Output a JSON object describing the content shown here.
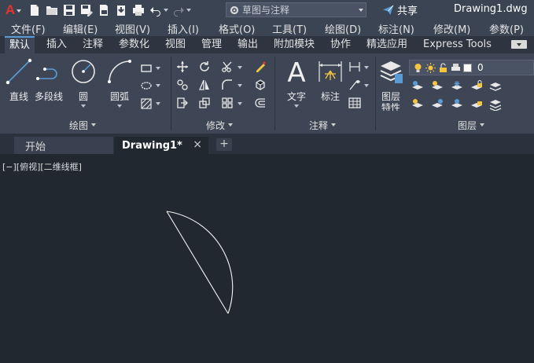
{
  "titlebar": {
    "logo_letter": "A",
    "search_placeholder": "草图与注释",
    "share_label": "共享",
    "document_title": "Drawing1.dwg",
    "qat_icons": [
      "new-icon",
      "open-icon",
      "save-icon",
      "save-as-icon",
      "publish-icon",
      "import-icon",
      "plot-icon",
      "undo-icon",
      "redo-icon"
    ]
  },
  "menu": {
    "items": [
      "文件(F)",
      "编辑(E)",
      "视图(V)",
      "插入(I)",
      "格式(O)",
      "工具(T)",
      "绘图(D)",
      "标注(N)",
      "修改(M)",
      "参数(P)"
    ]
  },
  "ribbon_tabs": {
    "items": [
      "默认",
      "插入",
      "注释",
      "参数化",
      "视图",
      "管理",
      "输出",
      "附加模块",
      "协作",
      "精选应用",
      "Express Tools"
    ],
    "active_index": 0
  },
  "ribbon": {
    "draw": {
      "footer": "绘图",
      "tools": [
        "直线",
        "多段线",
        "圆",
        "圆弧"
      ]
    },
    "modify": {
      "footer": "修改"
    },
    "annotation": {
      "footer": "注释",
      "tools": [
        "文字",
        "标注"
      ]
    },
    "layers": {
      "footer": "图层",
      "tool_line1": "图层",
      "tool_line2": "特性",
      "current_layer": "0"
    }
  },
  "file_tabs": {
    "start": "开始",
    "active": "Drawing1*",
    "close_glyph": "×",
    "new_glyph": "+"
  },
  "viewport": {
    "label": "[−][俯视][二维线框]"
  },
  "colors": {
    "titlebar_bg": "#3b4453",
    "ribbon_bg": "#3e4656",
    "canvas_bg": "#212830",
    "logo_red": "#e8322e",
    "accent_blue": "#5a9bd5",
    "sun_yellow": "#f5c542"
  }
}
